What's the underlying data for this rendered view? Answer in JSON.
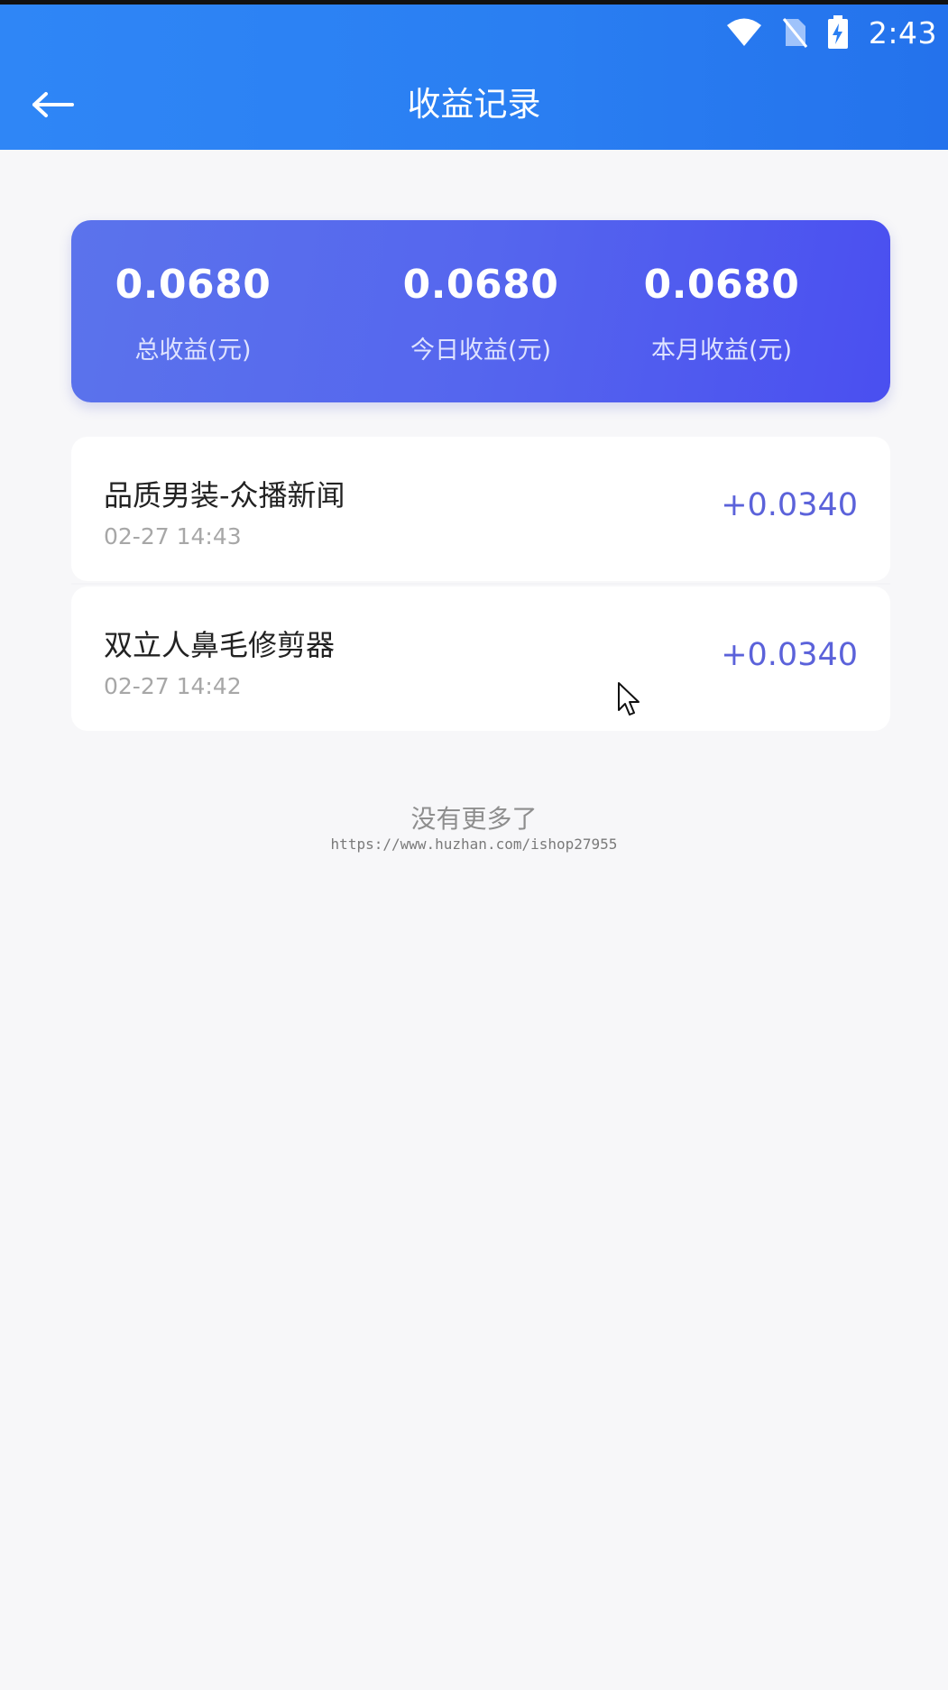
{
  "status_bar": {
    "time": "2:43",
    "icons": [
      "wifi-icon",
      "no-sim-icon",
      "battery-charging-icon"
    ]
  },
  "header": {
    "title": "收益记录",
    "back_icon": "arrow-left-icon"
  },
  "summary": {
    "total": {
      "value": "0.0680",
      "label": "总收益(元)"
    },
    "today": {
      "value": "0.0680",
      "label": "今日收益(元)"
    },
    "month": {
      "value": "0.0680",
      "label": "本月收益(元)"
    }
  },
  "records": [
    {
      "title": "品质男装-众播新闻",
      "date": "02-27 14:43",
      "amount": "+0.0340"
    },
    {
      "title": "双立人鼻毛修剪器",
      "date": "02-27 14:42",
      "amount": "+0.0340"
    }
  ],
  "footer": {
    "no_more": "没有更多了",
    "watermark": "https://www.huzhan.com/ishop27955"
  },
  "colors": {
    "header": "#2a7ff2",
    "card": "#5566ee",
    "amount": "#5b62da",
    "background": "#f7f7f9"
  }
}
